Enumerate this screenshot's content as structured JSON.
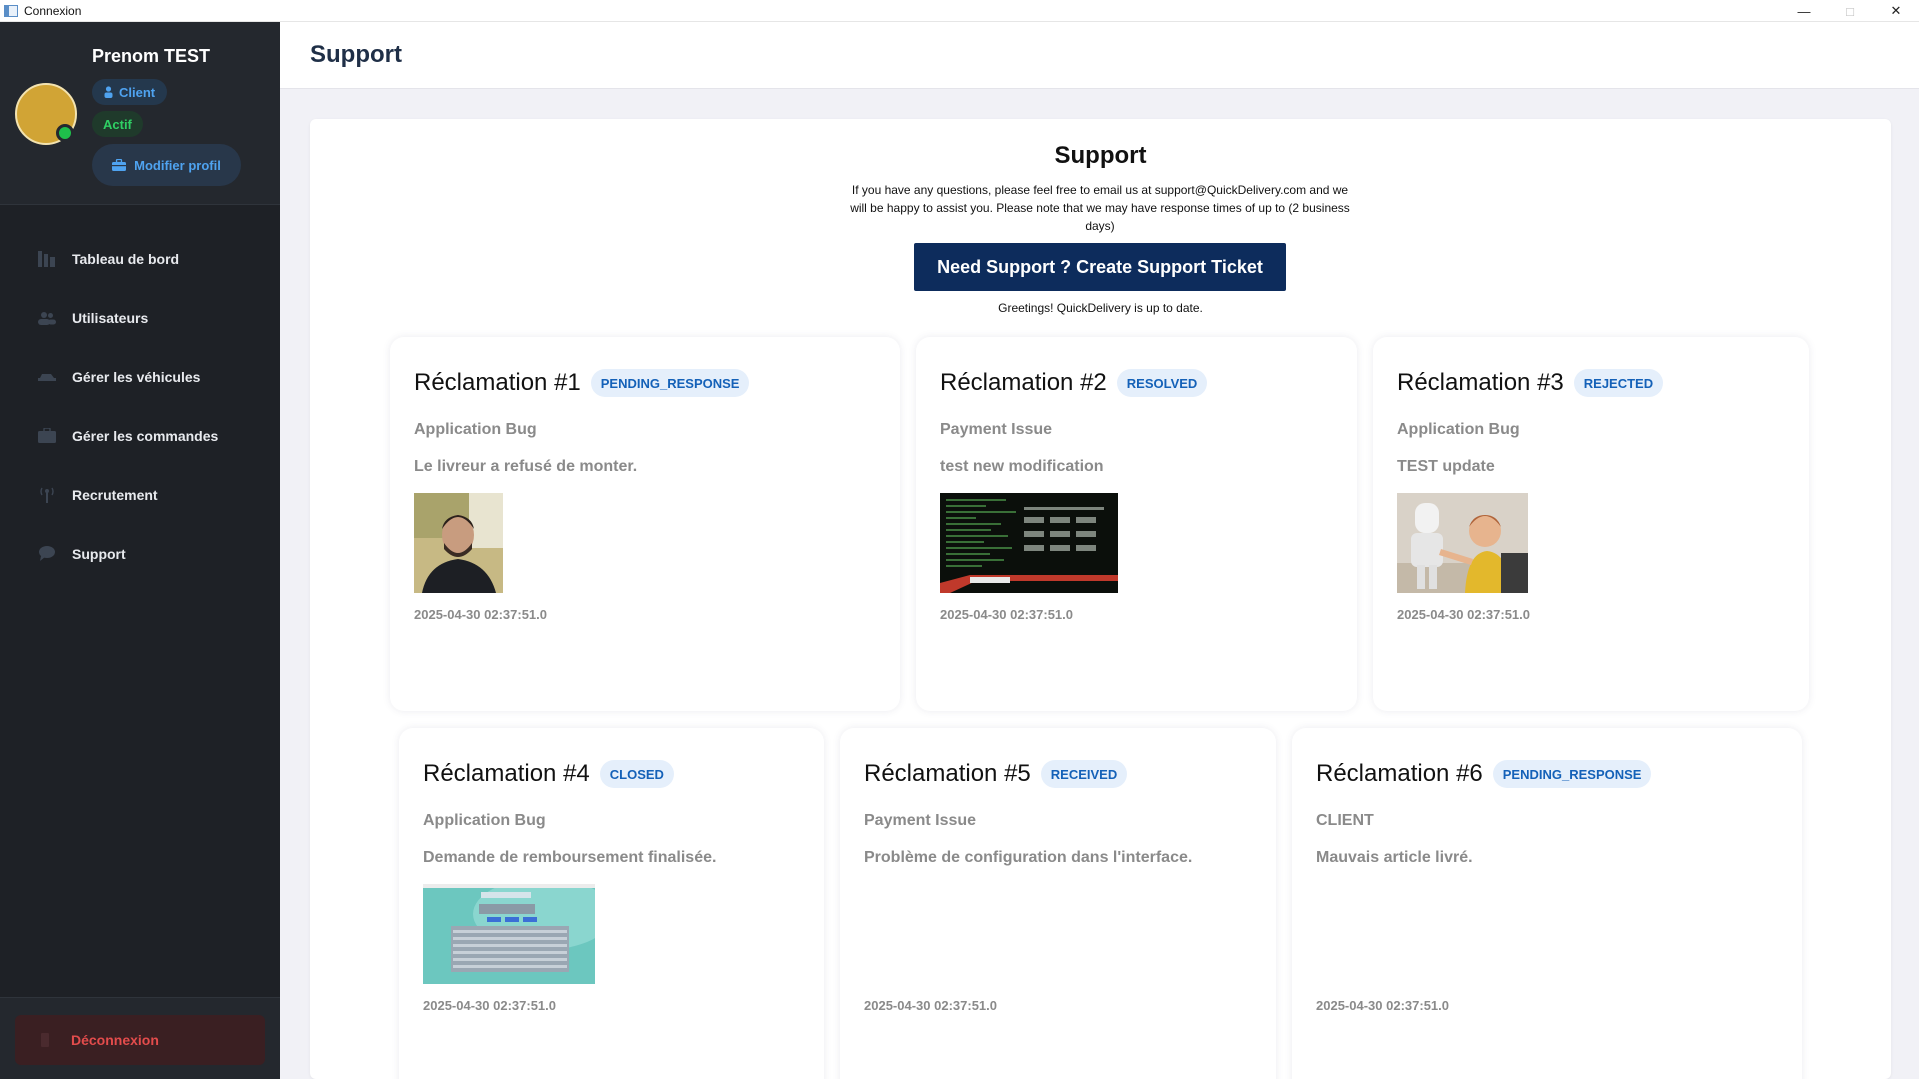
{
  "window": {
    "title": "Connexion",
    "minimize": "—",
    "maximize": "□",
    "close": "✕"
  },
  "profile": {
    "name": "Prenom TEST",
    "role": "Client",
    "status": "Actif",
    "edit_label": "Modifier profil"
  },
  "nav": [
    {
      "label": "Tableau de bord",
      "icon": "dashboard-icon"
    },
    {
      "label": "Utilisateurs",
      "icon": "users-icon"
    },
    {
      "label": "Gérer les véhicules",
      "icon": "car-icon"
    },
    {
      "label": "Gérer les commandes",
      "icon": "briefcase-icon"
    },
    {
      "label": "Recrutement",
      "icon": "antenna-icon"
    },
    {
      "label": "Support",
      "icon": "chat-icon"
    }
  ],
  "logout_label": "Déconnexion",
  "header": {
    "title": "Support"
  },
  "support": {
    "title": "Support",
    "description": "If you have any questions, please feel free to email us at support@QuickDelivery.com and we will be happy to assist you. Please note that we may have response times of up to (2 business days)",
    "cta_label": "Need Support ? Create Support Ticket",
    "greeting": "Greetings! QuickDelivery is up to date."
  },
  "tickets": [
    {
      "title": "Réclamation #1",
      "status": "PENDING_RESPONSE",
      "category": "Application Bug",
      "description": "Le livreur a refusé de monter.",
      "date": "2025-04-30 02:37:51.0",
      "image": "portrait-photo"
    },
    {
      "title": "Réclamation #2",
      "status": "RESOLVED",
      "category": "Payment Issue",
      "description": "test new modification",
      "date": "2025-04-30 02:37:51.0",
      "image": "terminal-screenshot"
    },
    {
      "title": "Réclamation #3",
      "status": "REJECTED",
      "category": "Application Bug",
      "description": "TEST update",
      "date": "2025-04-30 02:37:51.0",
      "image": "robot-child-photo"
    },
    {
      "title": "Réclamation #4",
      "status": "CLOSED",
      "category": "Application Bug",
      "description": "Demande de remboursement finalisée.",
      "date": "2025-04-30 02:37:51.0",
      "image": "app-screenshot"
    },
    {
      "title": "Réclamation #5",
      "status": "RECEIVED",
      "category": "Payment Issue",
      "description": "Problème de configuration dans l'interface.",
      "date": "2025-04-30 02:37:51.0",
      "image": null
    },
    {
      "title": "Réclamation #6",
      "status": "PENDING_RESPONSE",
      "category": "CLIENT",
      "description": "Mauvais article livré.",
      "date": "2025-04-30 02:37:51.0",
      "image": null
    }
  ]
}
